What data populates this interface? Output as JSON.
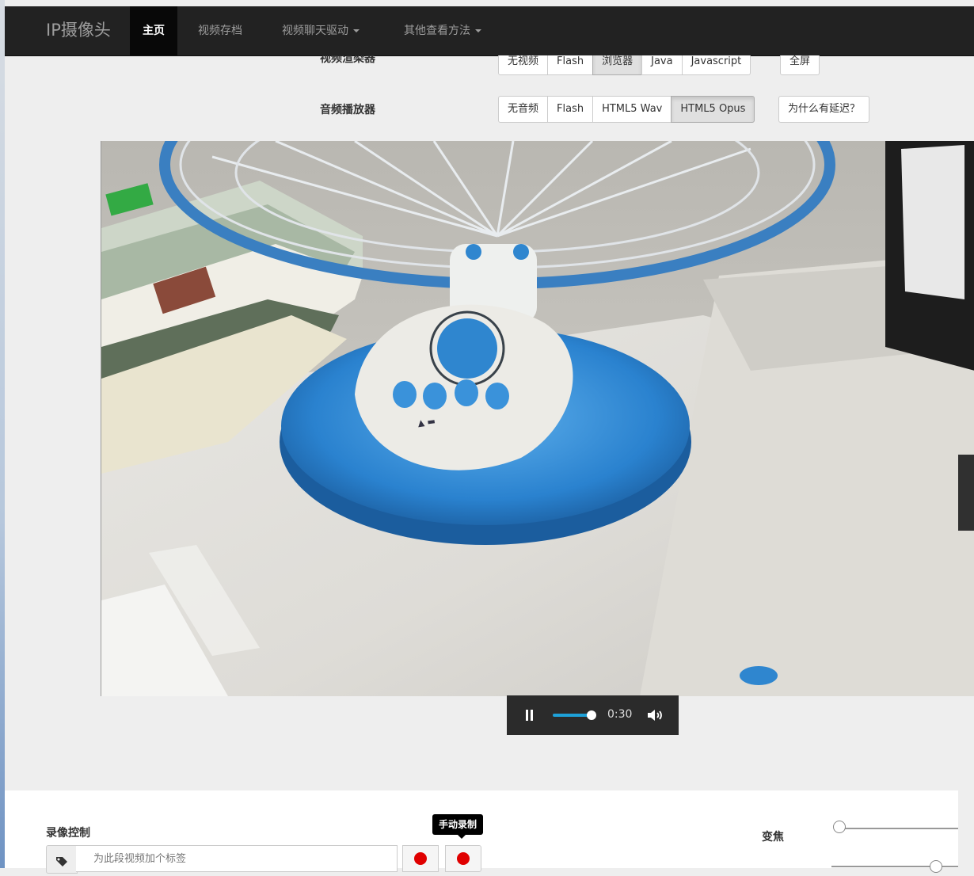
{
  "navbar": {
    "brand": "IP摄像头",
    "items": [
      {
        "label": "主页",
        "active": true
      },
      {
        "label": "视频存档",
        "active": false
      },
      {
        "label": "视频聊天驱动",
        "active": false,
        "dropdown": true
      },
      {
        "label": "其他查看方法",
        "active": false,
        "dropdown": true
      }
    ]
  },
  "video_renderer": {
    "label": "视频渲染器",
    "options": [
      "无视频",
      "Flash",
      "浏览器",
      "Java",
      "Javascript"
    ],
    "selected": "浏览器",
    "fullscreen": "全屏"
  },
  "audio_player": {
    "label": "音频播放器",
    "options": [
      "无音频",
      "Flash",
      "HTML5 Wav",
      "HTML5 Opus"
    ],
    "selected": "HTML5 Opus",
    "why_delay": "为什么有延迟？"
  },
  "player": {
    "time": "0:30",
    "progress": 0.9
  },
  "recording": {
    "label": "录像控制",
    "tag_placeholder": "为此段视频加个标签",
    "tooltip": "手动录制"
  },
  "zoom": {
    "label": "变焦",
    "zoom_level": 0.0,
    "second_slider_level": 0.85
  },
  "colors": {
    "navbar": "#222222",
    "accent": "#1ea1d8",
    "fan_blue": "#2f86cf",
    "record_red": "#e00000"
  }
}
